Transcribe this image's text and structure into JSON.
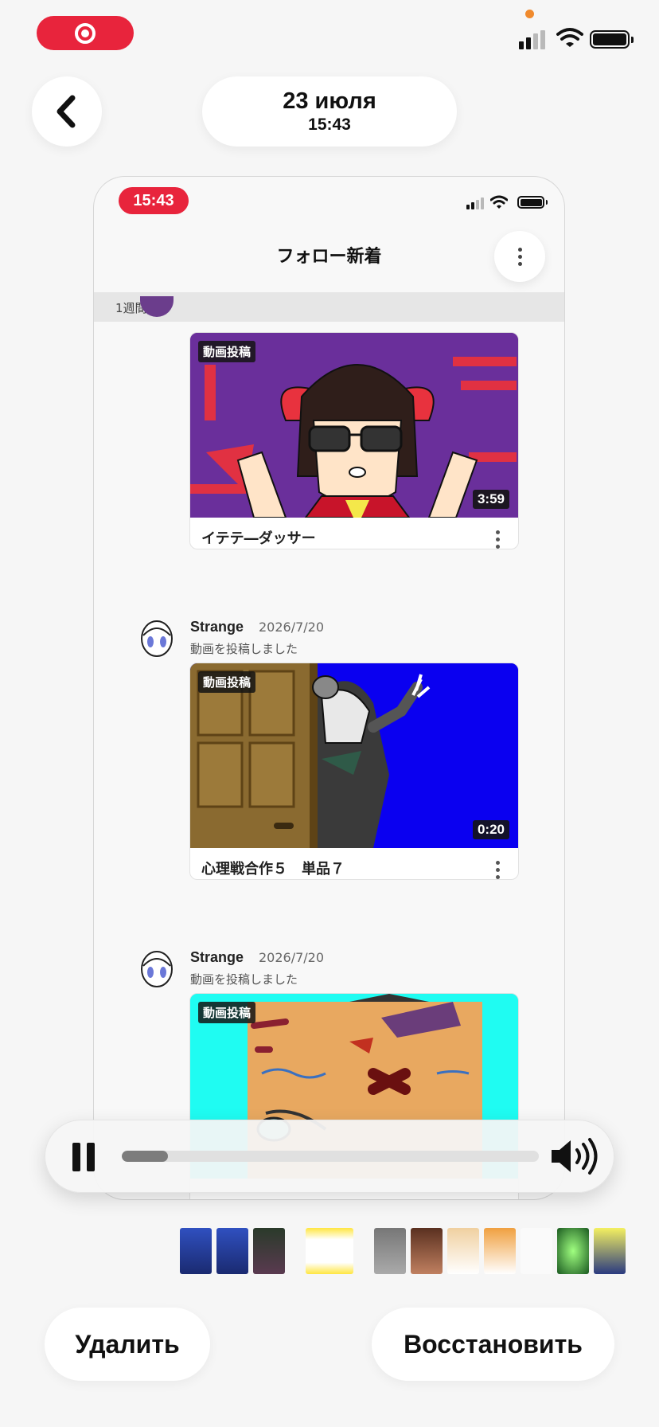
{
  "header": {
    "date": "23 июля",
    "time": "15:43"
  },
  "icons": {
    "back": "chevron-left-icon",
    "record": "record-icon",
    "more": "more-vertical-icon",
    "pause": "pause-icon",
    "volume": "volume-icon"
  },
  "phone": {
    "status_time": "15:43",
    "title": "フォロー新着",
    "section_label": "1週間",
    "posts": [
      {
        "badge": "動画投稿",
        "duration": "3:59",
        "title": "イテテ―ダッサー"
      },
      {
        "author": "Strange",
        "date": "2026/7/20",
        "action": "動画を投稿しました",
        "badge": "動画投稿",
        "duration": "0:20",
        "title": "心理戦合作５　単品７"
      },
      {
        "author": "Strange",
        "date": "2026/7/20",
        "action": "動画を投稿しました",
        "badge": "動画投稿"
      }
    ]
  },
  "player": {
    "state": "playing",
    "progress": 0.11
  },
  "actions": {
    "delete_label": "Удалить",
    "restore_label": "Восстановить"
  },
  "colors": {
    "accent_red": "#e8243c",
    "background": "#f6f6f6"
  }
}
